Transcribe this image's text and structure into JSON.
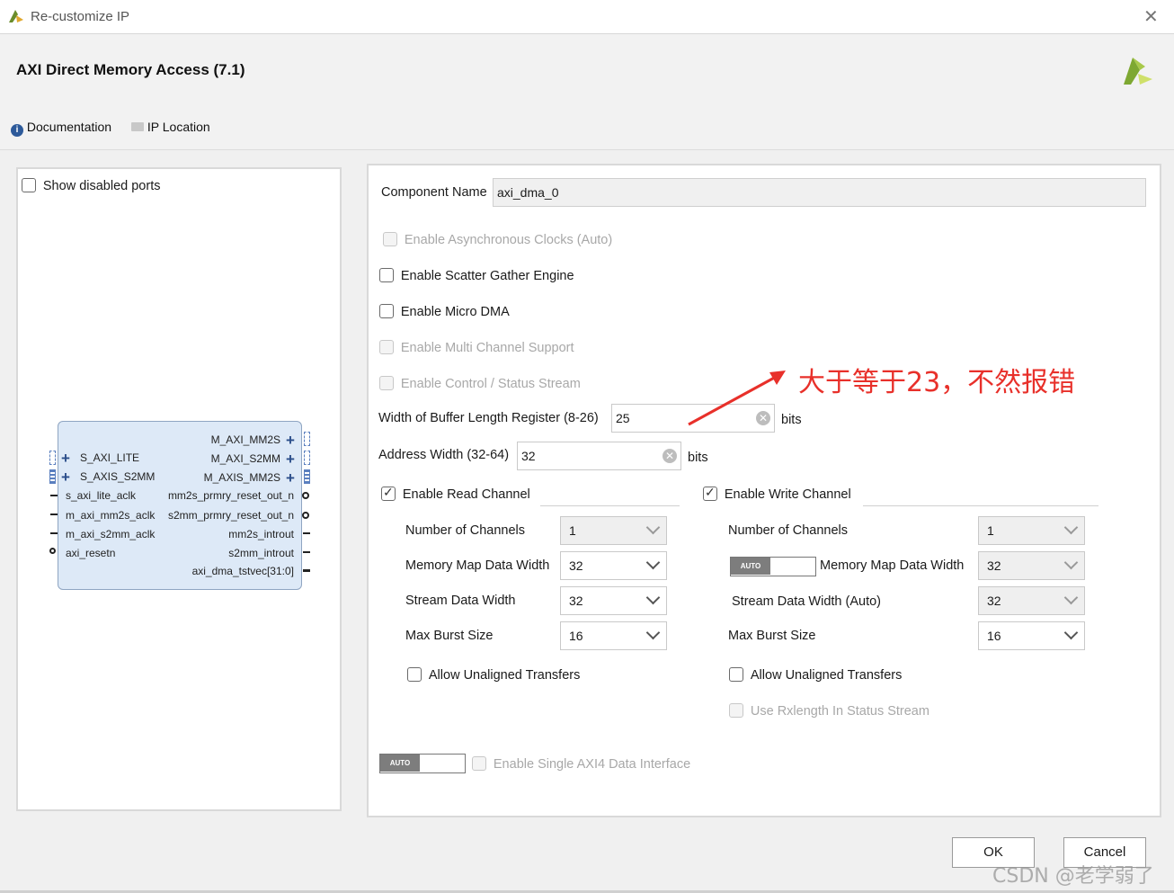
{
  "window": {
    "title": "Re-customize IP",
    "ip_name": "AXI Direct Memory Access (7.1)"
  },
  "header_links": {
    "documentation": "Documentation",
    "ip_location": "IP Location"
  },
  "left": {
    "show_disabled_ports": "Show disabled ports",
    "block": {
      "left_ports": [
        "S_AXI_LITE",
        "S_AXIS_S2MM",
        "s_axi_lite_aclk",
        "m_axi_mm2s_aclk",
        "m_axi_s2mm_aclk",
        "axi_resetn"
      ],
      "right_ports": [
        "M_AXI_MM2S",
        "M_AXI_S2MM",
        "M_AXIS_MM2S",
        "mm2s_prmry_reset_out_n",
        "s2mm_prmry_reset_out_n",
        "mm2s_introut",
        "s2mm_introut",
        "axi_dma_tstvec[31:0]"
      ]
    }
  },
  "config": {
    "component_name_label": "Component Name",
    "component_name_value": "axi_dma_0",
    "async_clocks": "Enable Asynchronous Clocks (Auto)",
    "scatter_gather": "Enable Scatter Gather Engine",
    "micro_dma": "Enable Micro DMA",
    "multi_channel": "Enable Multi Channel Support",
    "control_status": "Enable Control / Status Stream",
    "buffer_len_label": "Width of Buffer Length Register (8-26)",
    "buffer_len_value": "25",
    "address_width_label": "Address Width (32-64)",
    "address_width_value": "32",
    "bits": "bits",
    "read": {
      "title": "Enable Read Channel",
      "num_channels_label": "Number of Channels",
      "num_channels_value": "1",
      "mm_width_label": "Memory Map Data Width",
      "mm_width_value": "32",
      "stream_width_label": "Stream Data Width",
      "stream_width_value": "32",
      "burst_label": "Max Burst Size",
      "burst_value": "16",
      "unaligned": "Allow Unaligned Transfers"
    },
    "write": {
      "title": "Enable Write Channel",
      "num_channels_label": "Number of Channels",
      "num_channels_value": "1",
      "mm_width_label": "Memory Map Data Width",
      "mm_width_value": "32",
      "stream_width_label": "Stream Data Width (Auto)",
      "stream_width_value": "32",
      "burst_label": "Max Burst Size",
      "burst_value": "16",
      "unaligned": "Allow Unaligned Transfers",
      "rxlength": "Use Rxlength In Status Stream"
    },
    "auto_badge": "AUTO",
    "single_axi4": "Enable Single AXI4 Data Interface"
  },
  "buttons": {
    "ok": "OK",
    "cancel": "Cancel"
  },
  "annotation": "大于等于23，不然报错",
  "watermark": "CSDN @老学弱了",
  "colors": {
    "annotation": "#e8302a",
    "block_fill": "#dde9f7",
    "logo_green": "#8cb63c"
  }
}
